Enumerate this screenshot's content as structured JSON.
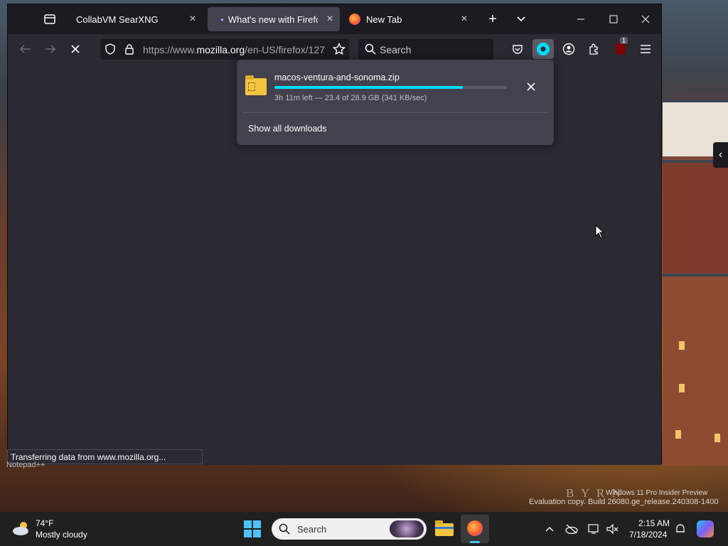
{
  "tabs": [
    {
      "title": "CollabVM SearXNG",
      "active": false
    },
    {
      "title": "What's new with Firefox -",
      "active": true
    },
    {
      "title": "New Tab",
      "active": false
    }
  ],
  "toolbar": {
    "url_prefix": "https://www.",
    "url_domain": "mozilla.org",
    "url_suffix": "/en-US/firefox/127",
    "search_placeholder": "Search",
    "addon_badge": "1"
  },
  "download": {
    "file_name": "macos-ventura-and-sonoma.zip",
    "progress": 0.81,
    "status": "3h 11m left — 23.4 of 28.9 GB (341 KB/sec)",
    "show_all": "Show all downloads"
  },
  "status_text": "Transferring data from www.mozilla.org...",
  "desktop": {
    "notepad_label": "Notepad++",
    "photo_credit": "B Y R N",
    "watermark_line1": "Windows 11 Pro Insider Preview",
    "watermark_line2": "Evaluation copy. Build 26080.ge_release.240308-1400"
  },
  "taskbar": {
    "weather_temp": "74°F",
    "weather_desc": "Mostly cloudy",
    "search_label": "Search",
    "time": "2:15 AM",
    "date": "7/18/2024"
  },
  "colors": {
    "accent": "#00ddff",
    "tab_active": "#42414d",
    "toolbar": "#2b2a33"
  }
}
